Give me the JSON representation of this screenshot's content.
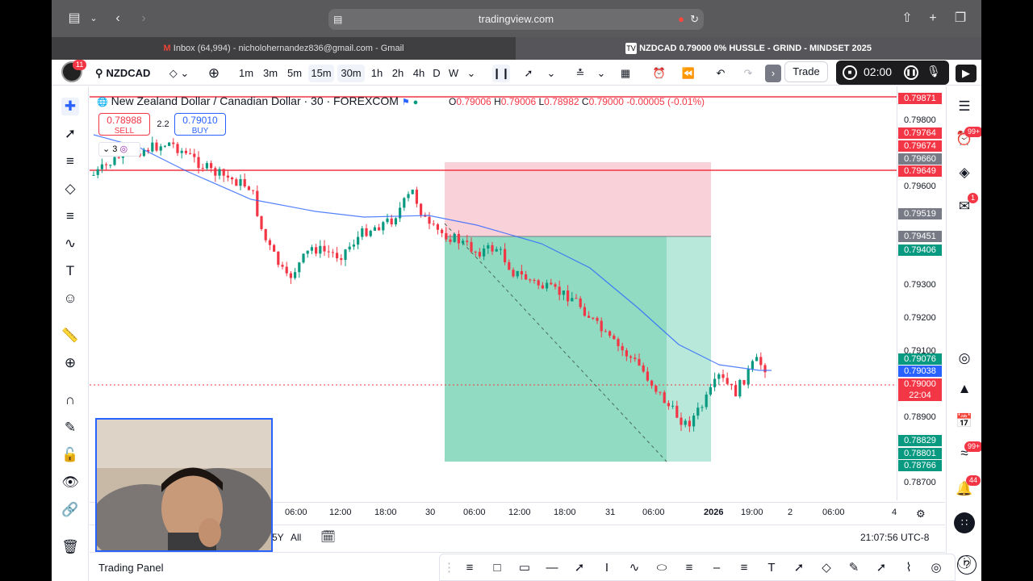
{
  "browser": {
    "url": "tradingview.com",
    "tabs": [
      {
        "label": "Inbox (64,994) - nicholohernandez836@gmail.com - Gmail",
        "icon": "gmail-icon"
      },
      {
        "label": "NZDCAD 0.79000 0% HUSSLE - GRIND - MINDSET 2025",
        "icon": "tradingview-icon"
      }
    ]
  },
  "toolbar": {
    "avatar_badge": "11",
    "symbol": "NZDCAD",
    "intervals": [
      "1m",
      "3m",
      "5m",
      "15m",
      "30m",
      "1h",
      "2h",
      "4h",
      "D",
      "W"
    ],
    "selected_interval": "30m",
    "trade_label": "Trade",
    "timer": "02:00"
  },
  "legend": {
    "title": "New Zealand Dollar / Canadian Dollar · 30 · FOREXCOM",
    "o_label": "O",
    "o": "0.79006",
    "h_label": "H",
    "h": "0.79006",
    "l_label": "L",
    "l": "0.78982",
    "c_label": "C",
    "c": "0.79000",
    "change": "-0.00005 (-0.01%)",
    "sell_price": "0.78988",
    "sell_label": "SELL",
    "spread": "2.2",
    "buy_price": "0.79010",
    "buy_label": "BUY",
    "indicator_count": "3"
  },
  "price_scale": {
    "ticks": [
      "0.79800",
      "0.79600",
      "0.79300",
      "0.79200",
      "0.79100",
      "0.78900",
      "0.78700"
    ],
    "labels": [
      {
        "value": "0.79871",
        "color": "#f23645"
      },
      {
        "value": "0.79764",
        "color": "#f23645"
      },
      {
        "value": "0.79674",
        "color": "#f23645"
      },
      {
        "value": "0.79660",
        "color": "#787b86"
      },
      {
        "value": "0.79649",
        "color": "#f23645"
      },
      {
        "value": "0.79519",
        "color": "#787b86"
      },
      {
        "value": "0.79451",
        "color": "#787b86"
      },
      {
        "value": "0.79406",
        "color": "#089981"
      },
      {
        "value": "0.79076",
        "color": "#089981"
      },
      {
        "value": "0.79038",
        "color": "#2962ff"
      },
      {
        "value": "0.79000",
        "color": "#f23645"
      },
      {
        "value": "22:04",
        "color": "#f23645"
      },
      {
        "value": "0.78829",
        "color": "#089981"
      },
      {
        "value": "0.78801",
        "color": "#089981"
      },
      {
        "value": "0.78766",
        "color": "#089981"
      }
    ]
  },
  "time_scale": {
    "labels": [
      "06:00",
      "12:00",
      "18:00",
      "30",
      "06:00",
      "12:00",
      "18:00",
      "31",
      "06:00",
      "2026",
      "19:00",
      "2",
      "06:00",
      "4"
    ]
  },
  "bottom": {
    "range_5y": "5Y",
    "range_all": "All",
    "clock": "21:07:56 UTC-8"
  },
  "panel": {
    "label": "Trading Panel"
  },
  "right_badges": {
    "alerts": "99+",
    "chat": "1",
    "notifications": "99+",
    "bell": "44"
  },
  "colors": {
    "up": "#089981",
    "down": "#f23645",
    "ma": "#2962ff",
    "stop_zone": "#f7c6cf",
    "target_zone": "#a6e2cf"
  }
}
